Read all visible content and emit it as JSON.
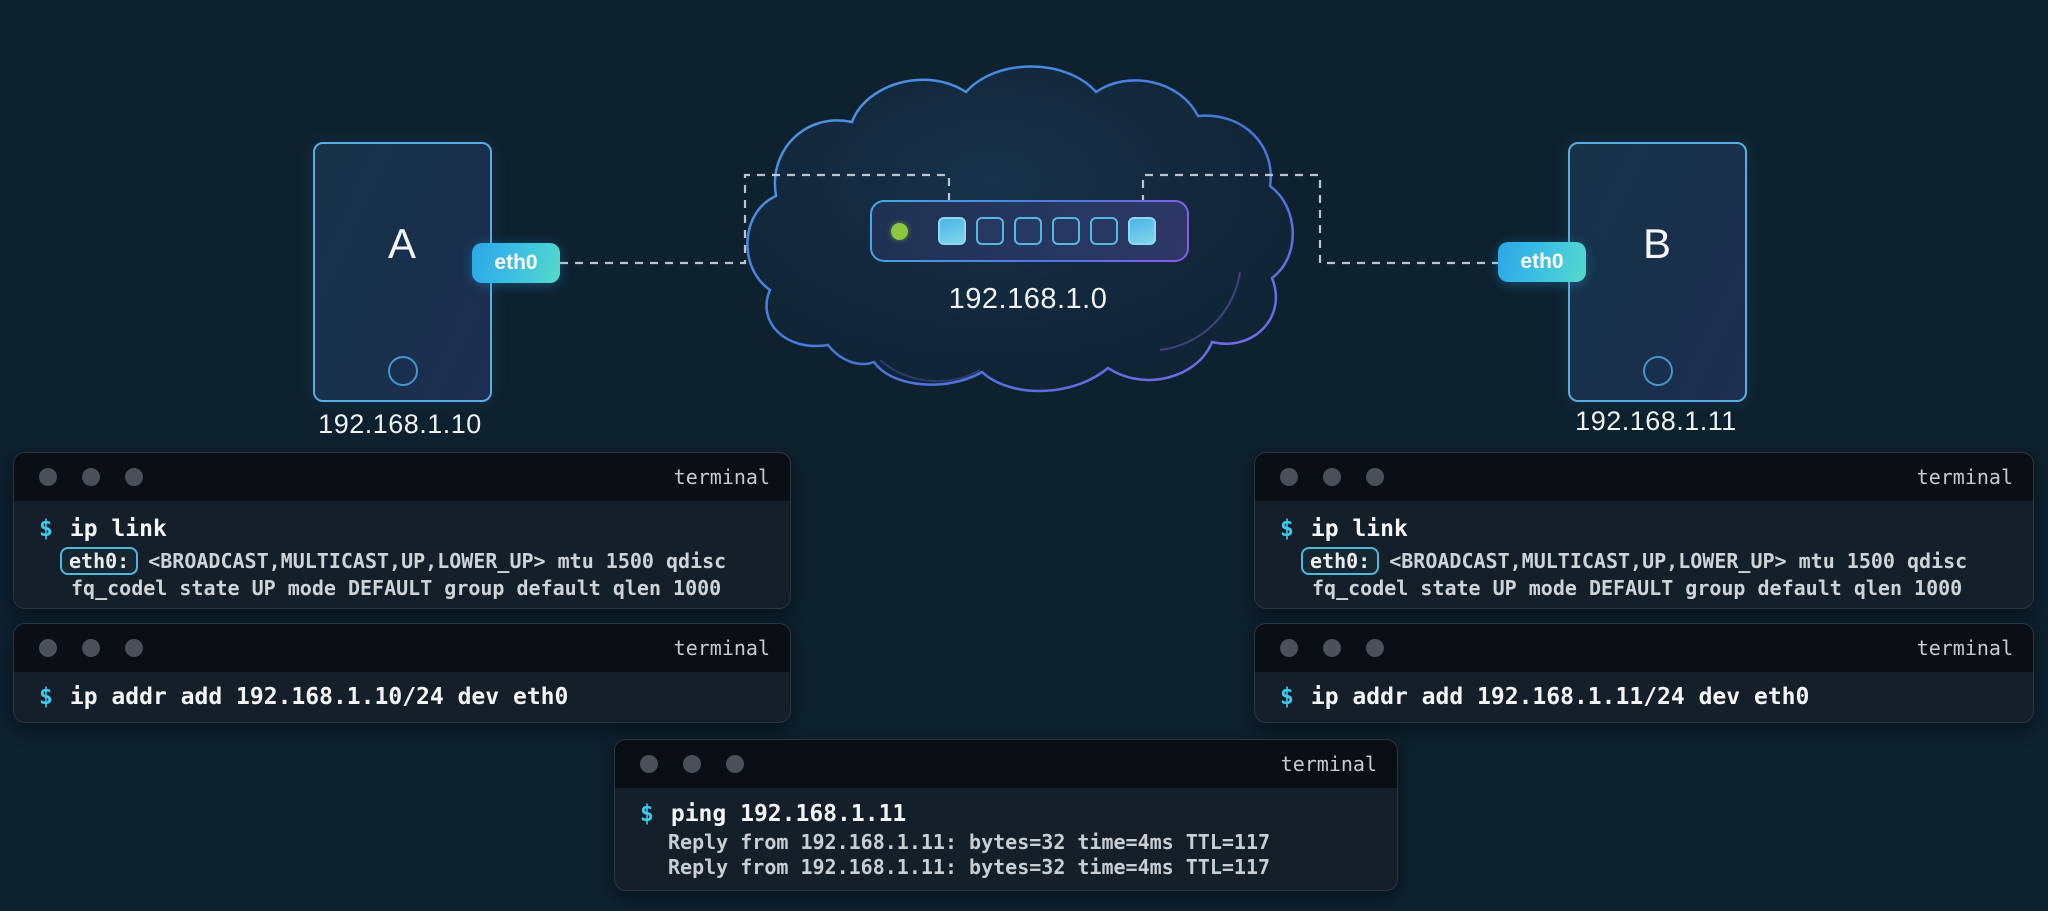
{
  "colors": {
    "background": "#0e212e",
    "accent_cyan": "#3fc8ea",
    "badge_gradient_start": "#2aa7e8",
    "badge_gradient_end": "#55dac9",
    "node_border": "#57aede",
    "cloud_stroke_start": "#4e9be0",
    "cloud_stroke_end": "#7e64e8",
    "led_green": "#8dc63f",
    "dashed_link": "#b9c6d2",
    "terminal_titlebar": "#0a0e15",
    "terminal_body": "#151f29"
  },
  "diagram": {
    "node_a": {
      "name": "A",
      "ip": "192.168.1.10",
      "iface": "eth0"
    },
    "node_b": {
      "name": "B",
      "ip": "192.168.1.11",
      "iface": "eth0"
    },
    "cloud": {
      "network": "192.168.1.0"
    },
    "switch": {
      "ports": 6,
      "active_ports": [
        1,
        6
      ],
      "led_status": "green"
    }
  },
  "terminals": {
    "window_title": "terminal",
    "prompt": "$",
    "a_top": {
      "command": "ip link",
      "tag": "eth0:",
      "flags": "<BROADCAST,MULTICAST,UP,LOWER_UP> mtu 1500 qdisc",
      "flags2": "fq_codel state UP mode DEFAULT group default qlen 1000"
    },
    "a_bottom": {
      "command": "ip addr add 192.168.1.10/24 dev eth0"
    },
    "b_top": {
      "command": "ip link",
      "tag": "eth0:",
      "flags": "<BROADCAST,MULTICAST,UP,LOWER_UP> mtu 1500 qdisc",
      "flags2": "fq_codel state UP mode DEFAULT group default qlen 1000"
    },
    "b_bottom": {
      "command": "ip addr add 192.168.1.11/24 dev eth0"
    },
    "center": {
      "command": "ping 192.168.1.11",
      "reply1": "Reply from 192.168.1.11: bytes=32 time=4ms TTL=117",
      "reply2": "Reply from 192.168.1.11: bytes=32 time=4ms TTL=117"
    }
  }
}
